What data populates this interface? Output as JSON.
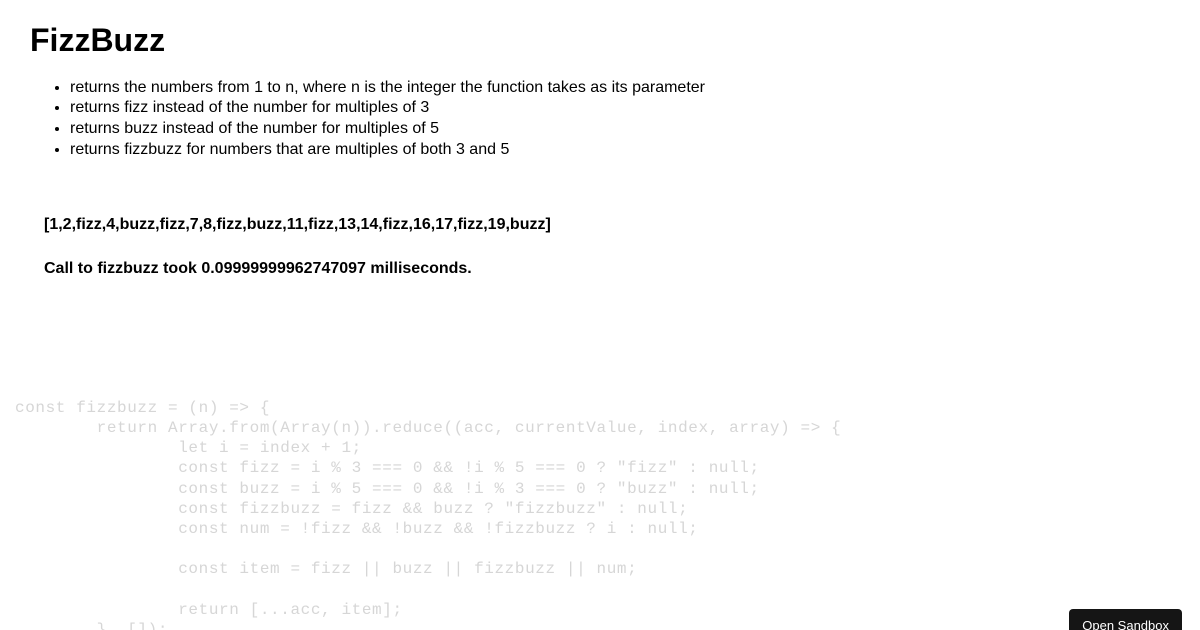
{
  "title": "FizzBuzz",
  "rules": [
    "returns the numbers from 1 to n, where n is the integer the function takes as its parameter",
    "returns fizz instead of the number for multiples of 3",
    "returns buzz instead of the number for multiples of 5",
    "returns fizzbuzz for numbers that are multiples of both 3 and 5"
  ],
  "output": {
    "result": "[1,2,fizz,4,buzz,fizz,7,8,fizz,buzz,11,fizz,13,14,fizz,16,17,fizz,19,buzz]",
    "timing": "Call to fizzbuzz took 0.09999999962747097 milliseconds."
  },
  "code": "const fizzbuzz = (n) => {\n        return Array.from(Array(n)).reduce((acc, currentValue, index, array) => {\n                let i = index + 1;\n                const fizz = i % 3 === 0 && !i % 5 === 0 ? \"fizz\" : null;\n                const buzz = i % 5 === 0 && !i % 3 === 0 ? \"buzz\" : null;\n                const fizzbuzz = fizz && buzz ? \"fizzbuzz\" : null;\n                const num = !fizz && !buzz && !fizzbuzz ? i : null;\n\n                const item = fizz || buzz || fizzbuzz || num;\n\n                return [...acc, item];\n        }, []);\n};",
  "sandbox_button": "Open Sandbox"
}
